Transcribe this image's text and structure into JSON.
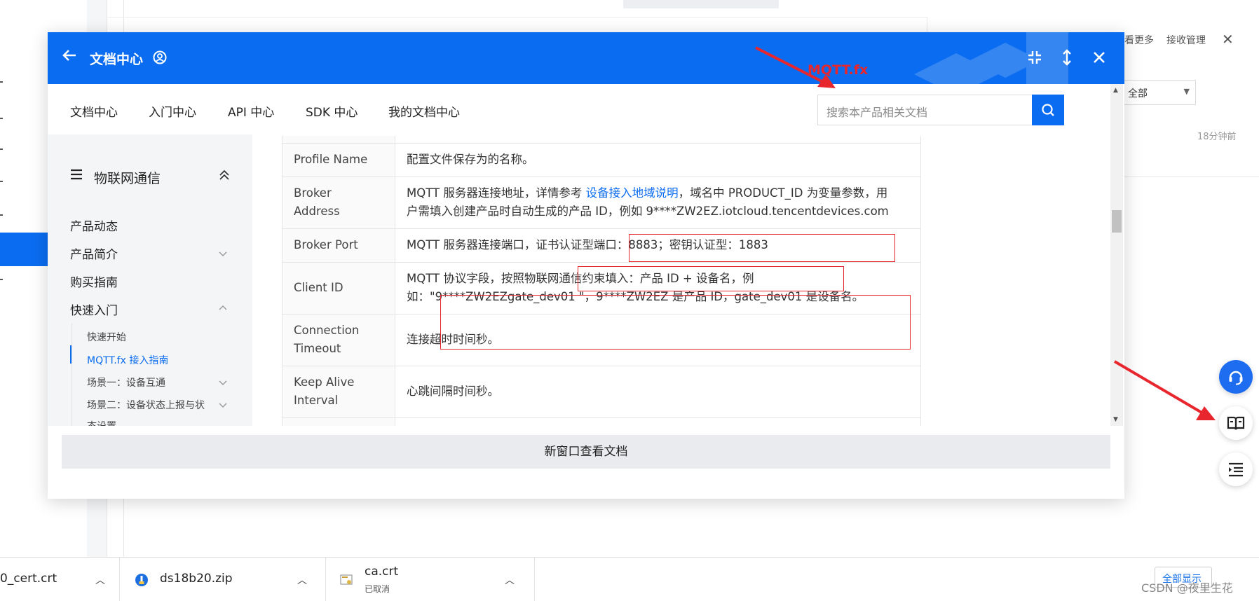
{
  "background": {
    "right_panel": {
      "more_text": "看更多",
      "receive_manage": "接收管理",
      "filter_label": "全部",
      "time": "18分钟前"
    }
  },
  "dialog": {
    "title": "文档中心",
    "nav_tabs": [
      "文档中心",
      "入门中心",
      "API 中心",
      "SDK 中心",
      "我的文档中心"
    ],
    "search_placeholder": "搜索本产品相关文档",
    "annotation": "MQTT.fx",
    "sidebar": {
      "title": "物联网通信",
      "items": [
        "产品动态",
        "产品简介",
        "购买指南",
        "快速入门"
      ],
      "subitems": [
        "快速开始",
        "MQTT.fx 接入指南",
        "场景一：设备互通",
        "场景二：设备状态上报与状",
        "态设置"
      ]
    },
    "table": {
      "rows": [
        {
          "key": "Profile Name",
          "value": "配置文件保存为的名称。"
        },
        {
          "key_lines": [
            "Broker",
            "Address"
          ],
          "value_pre": "MQTT 服务器连接地址，详情参考 ",
          "value_link": "设备接入地域说明",
          "value_post": "，域名中 PRODUCT_ID 为变量参数，用",
          "value_line2": "户需填入创建产品时自动生成的产品 ID，例如 9****ZW2EZ.iotcloud.tencentdevices.com"
        },
        {
          "key": "Broker Port",
          "value": "MQTT 服务器连接端口，证书认证型端口：8883；密钥认证型：1883"
        },
        {
          "key": "Client ID",
          "value_line1": "MQTT 协议字段，按照物联网通信约束填入：产品 ID + 设备名，例",
          "value_line2": "如：\"9****ZW2EZgate_dev01 \"，9****ZW2EZ 是产品 ID，gate_dev01 是设备名。"
        },
        {
          "key_lines": [
            "Connection",
            "Timeout"
          ],
          "value": "连接超时时间秒。"
        },
        {
          "key_lines": [
            "Keep Alive",
            "Interval"
          ],
          "value": "心跳间隔时间秒。"
        }
      ]
    },
    "footer_button": "新窗口查看文档"
  },
  "downloads": [
    {
      "name": "0_cert.crt"
    },
    {
      "name": "ds18b20.zip"
    },
    {
      "name": "ca.crt",
      "status": "已取消"
    }
  ],
  "download_show_all": "全部显示",
  "watermark": "CSDN @夜里生花",
  "colors": {
    "brand_blue": "#0a6cf0",
    "annotation_red": "#e8262d"
  }
}
